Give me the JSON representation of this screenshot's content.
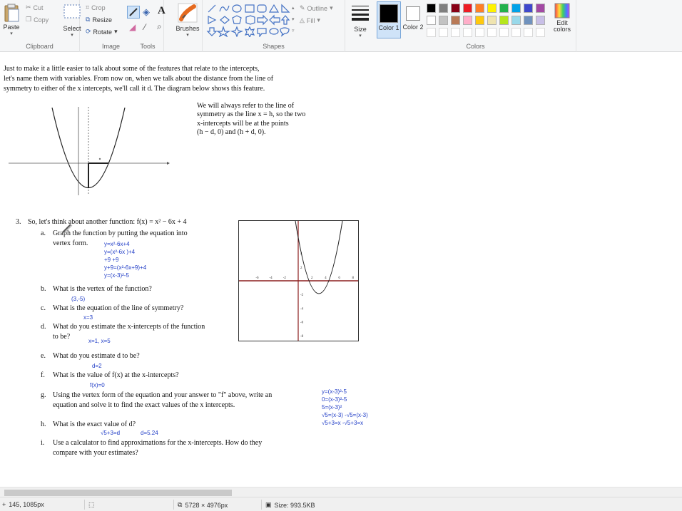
{
  "ribbon": {
    "clipboard": {
      "paste": "Paste",
      "cut": "Cut",
      "copy": "Copy",
      "label": "Clipboard"
    },
    "image": {
      "select": "Select",
      "crop": "Crop",
      "resize": "Resize",
      "rotate": "Rotate",
      "label": "Image"
    },
    "tools": {
      "label": "Tools",
      "text_tool": "A"
    },
    "brushes": {
      "label": "Brushes"
    },
    "shapes": {
      "outline": "Outline",
      "fill": "Fill",
      "label": "Shapes"
    },
    "size": {
      "label": "Size"
    },
    "colors": {
      "color1": "Color 1",
      "color2": "Color 2",
      "edit": "Edit colors",
      "label": "Colors",
      "palette_row1": [
        "#000000",
        "#7f7f7f",
        "#880015",
        "#ed1c24",
        "#ff7f27",
        "#fff200",
        "#22b14c",
        "#00a2e8",
        "#3f48cc",
        "#a349a4"
      ],
      "palette_row2": [
        "#ffffff",
        "#c3c3c3",
        "#b97a57",
        "#ffaec9",
        "#ffc90e",
        "#efe4b0",
        "#b5e61d",
        "#99d9ea",
        "#7092be",
        "#c8bfe7"
      ]
    }
  },
  "doc": {
    "intro": [
      "Just to make it a little easier to talk about some of the features that relate to the intercepts,",
      "let's name them with variables.  From now on, when we talk about the distance from the line of",
      "symmetry to either of the x intercepts, we'll call it d.  The diagram below shows this feature."
    ],
    "note": [
      "We will always refer to the line of",
      "symmetry as the line x = h, so the two",
      "x-intercepts will be at the points",
      "(h − d, 0) and (h + d, 0)."
    ],
    "q3": {
      "number": "3.",
      "prompt": "So, let's think about another function:  f(x) = x² − 6x + 4",
      "items": [
        {
          "letter": "a.",
          "lines": [
            "Graph the function by putting the equation into",
            "vertex form."
          ]
        },
        {
          "letter": "b.",
          "lines": [
            "What is the vertex of the function?"
          ]
        },
        {
          "letter": "c.",
          "lines": [
            "What is the equation of the line of symmetry?"
          ]
        },
        {
          "letter": "d.",
          "lines": [
            "What do you estimate the x-intercepts of the function",
            "to be?"
          ]
        },
        {
          "letter": "e.",
          "lines": [
            "What do you estimate d to be?"
          ]
        },
        {
          "letter": "f.",
          "lines": [
            "What is the value of f(x) at the x-intercepts?"
          ]
        },
        {
          "letter": "g.",
          "lines": [
            "Using the vertex form of the equation and your answer to \"f\" above, write an",
            "equation and solve it to find the exact values of the x intercepts."
          ]
        },
        {
          "letter": "h.",
          "lines": [
            "What is the exact value of d?"
          ]
        },
        {
          "letter": "i.",
          "lines": [
            "Use a calculator to find approximations for the x-intercepts.  How do they",
            "compare with your estimates?"
          ]
        }
      ]
    },
    "handwriting": {
      "a": [
        "y=x²-6x+4",
        "y=(x²-6x    )+4",
        "+9              +9",
        "y+9=(x²-6x+9)+4",
        "y=(x-3)²-5"
      ],
      "b": "(3,-5)",
      "c": "x=3",
      "d": "x=1,  x=5",
      "e": "d=2",
      "f": "f(x)=0",
      "g": [
        "y=(x-3)²-5",
        "0=(x-3)²-5",
        "5=(x-3)²",
        "√5=(x-3)   -√5=(x-3)",
        "√5+3=x     -√5+3=x"
      ],
      "h1": "√5+3=d",
      "h2": "d=5.24"
    },
    "graph_ticks": {
      "x": [
        "-6",
        "-4",
        "-2",
        "2",
        "4",
        "6",
        "8"
      ],
      "y": [
        "4",
        "2",
        "-2",
        "-4",
        "-6",
        "-8"
      ]
    }
  },
  "status": {
    "cursor": "145, 1085px",
    "dimensions": "5728 × 4976px",
    "size": "Size: 993.5KB"
  }
}
